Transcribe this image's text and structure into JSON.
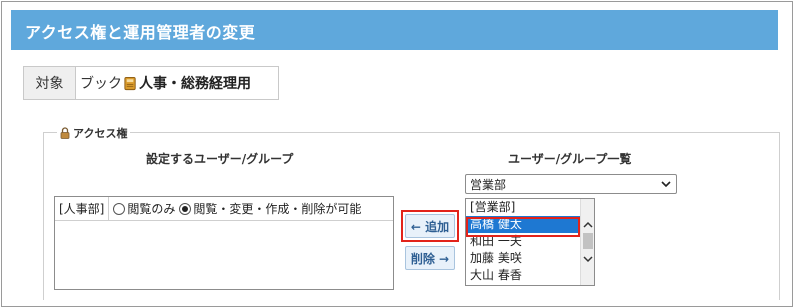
{
  "header": {
    "title": "アクセス権と運用管理者の変更"
  },
  "target": {
    "label": "対象",
    "book_prefix": "ブック",
    "book_name": "人事・総務経理用"
  },
  "access": {
    "legend": "アクセス権",
    "settings_heading": "設定するユーザー/グループ",
    "list_heading": "ユーザー/グループ一覧",
    "rows": [
      {
        "group": "[人事部]",
        "option_view": "閲覧のみ",
        "option_full": "閲覧・変更・作成・削除が可能",
        "selected": "option_full"
      }
    ]
  },
  "buttons": {
    "add": "← 追加",
    "remove": "削除 →"
  },
  "dropdown": {
    "selected": "営業部"
  },
  "listbox": {
    "items": [
      "[営業部]",
      "高橋 健太",
      "和田 一夫",
      "加藤 美咲",
      "大山 春香"
    ],
    "selected_index": 1
  },
  "colors": {
    "header_bg": "#5fa8dc",
    "highlight": "#e2231a",
    "selection": "#1e78d2"
  },
  "icons": {
    "book": "book-icon",
    "lock": "lock-icon",
    "dropdown": "chevron-down-icon"
  }
}
